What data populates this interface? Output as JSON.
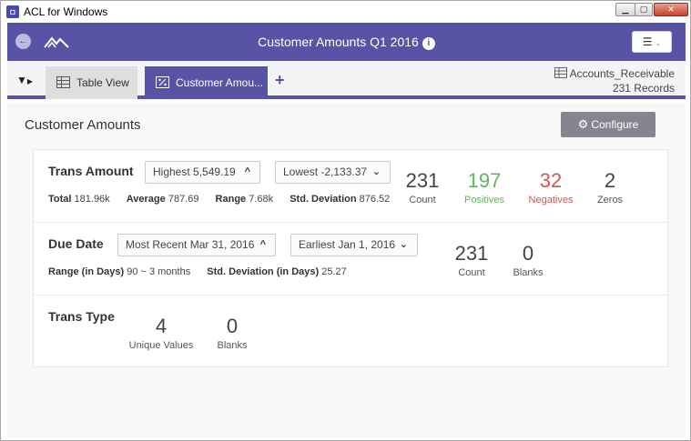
{
  "window": {
    "title": "ACL for Windows",
    "close_label": "✕",
    "min_label": "▁",
    "max_label": "▢"
  },
  "header": {
    "title": "Customer Amounts Q1 2016",
    "back_icon": "arrow-left-icon",
    "info_icon": "info-icon",
    "menu_icon": "hamburger-icon",
    "accent": "#5853a5"
  },
  "tabs": [
    {
      "label": "Table View",
      "icon": "table-icon"
    },
    {
      "label": "Customer Amou...",
      "icon": "percent-icon"
    }
  ],
  "table_info": {
    "name": "Accounts_Receivable",
    "records": "231 Records"
  },
  "section": {
    "title": "Customer Amounts",
    "configure_label": "Configure"
  },
  "fields": [
    {
      "name": "Trans Amount",
      "dropdown_high": "Highest 5,549.19",
      "dropdown_low": "Lowest -2,133.37",
      "stats": [
        {
          "label": "Total",
          "value": "181.96k"
        },
        {
          "label": "Average",
          "value": "787.69"
        },
        {
          "label": "Range",
          "value": "7.68k"
        },
        {
          "label": "Std. Deviation",
          "value": "876.52"
        }
      ],
      "metrics": [
        {
          "value": "231",
          "label": "Count"
        },
        {
          "value": "197",
          "label": "Positives"
        },
        {
          "value": "32",
          "label": "Negatives"
        },
        {
          "value": "2",
          "label": "Zeros"
        }
      ]
    },
    {
      "name": "Due Date",
      "dropdown_high": "Most Recent Mar 31, 2016",
      "dropdown_low": "Earliest Jan 1, 2016",
      "stats": [
        {
          "label": "Range (in Days)",
          "value": "90 ~ 3 months"
        },
        {
          "label": "Std. Deviation (in Days)",
          "value": "25.27"
        }
      ],
      "metrics": [
        {
          "value": "231",
          "label": "Count"
        },
        {
          "value": "0",
          "label": "Blanks"
        }
      ]
    },
    {
      "name": "Trans Type",
      "metrics": [
        {
          "value": "4",
          "label": "Unique Values"
        },
        {
          "value": "0",
          "label": "Blanks"
        }
      ]
    }
  ]
}
